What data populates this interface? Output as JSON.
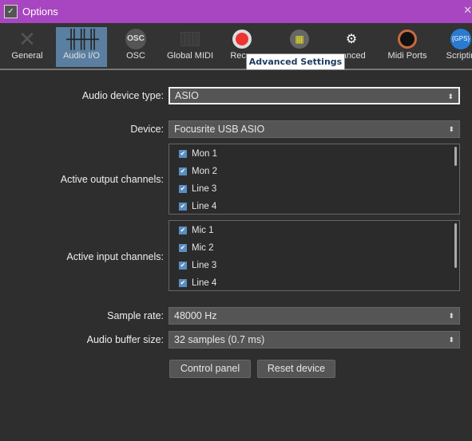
{
  "window": {
    "title": "Options",
    "close": "✕"
  },
  "tabs": [
    {
      "label": "General",
      "icon": "wrench-screwdriver-icon"
    },
    {
      "label": "Audio I/O",
      "icon": "sliders-icon",
      "selected": true
    },
    {
      "label": "OSC",
      "icon": "osc-icon"
    },
    {
      "label": "Global MIDI",
      "icon": "piano-keys-icon"
    },
    {
      "label": "Recor",
      "icon": "record-icon"
    },
    {
      "label": "",
      "icon": "grid-icon"
    },
    {
      "label": "vanced",
      "icon": "shield-gear-icon"
    },
    {
      "label": "Midi Ports",
      "icon": "midi-port-icon"
    },
    {
      "label": "Scriptin",
      "icon": "gps-icon"
    }
  ],
  "tooltip": "Advanced Settings",
  "form": {
    "device_type_label": "Audio device type:",
    "device_type": "ASIO",
    "device_label": "Device:",
    "device": "Focusrite USB ASIO",
    "outputs_label": "Active output channels:",
    "outputs": [
      "Mon 1",
      "Mon 2",
      "Line 3",
      "Line 4"
    ],
    "inputs_label": "Active input channels:",
    "inputs": [
      "Mic 1",
      "Mic 2",
      "Line 3",
      "Line 4"
    ],
    "sample_rate_label": "Sample rate:",
    "sample_rate": "48000 Hz",
    "buffer_label": "Audio buffer size:",
    "buffer": "32 samples (0.7 ms)",
    "control_panel": "Control panel",
    "reset_device": "Reset device"
  }
}
